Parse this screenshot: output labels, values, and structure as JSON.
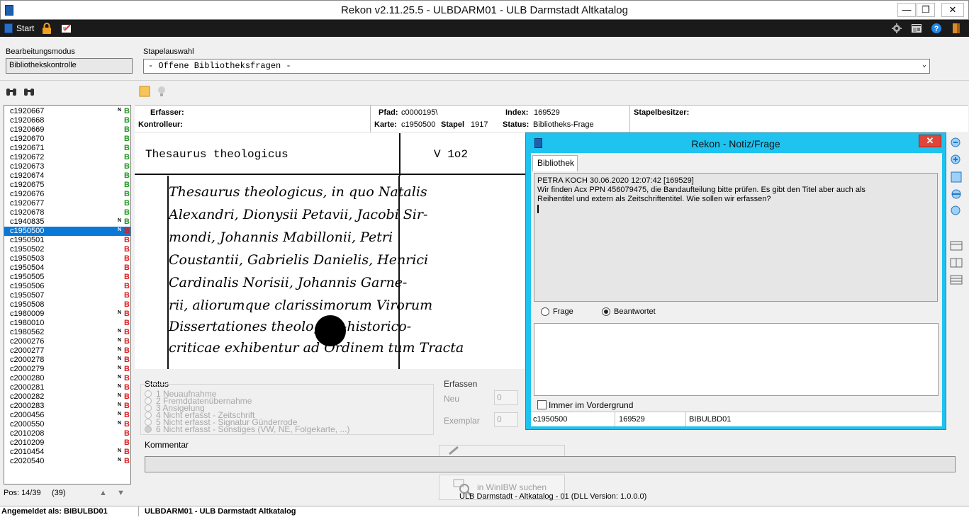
{
  "window": {
    "title": "Rekon v2.11.25.5 - ULBDARM01 - ULB Darmstadt Altkatalog",
    "minimize": "—",
    "restore": "❐",
    "close": "✕"
  },
  "toolbar": {
    "start_label": "Start"
  },
  "mode": {
    "label": "Bearbeitungsmodus",
    "value": "Bibliothekskontrolle",
    "batch_label": "Stapelauswahl",
    "batch_value": "- Offene Bibliotheksfragen -"
  },
  "records": [
    {
      "id": "c1920667",
      "n": "N",
      "s": "B",
      "c": "green"
    },
    {
      "id": "c1920668",
      "n": "",
      "s": "B",
      "c": "green"
    },
    {
      "id": "c1920669",
      "n": "",
      "s": "B",
      "c": "green"
    },
    {
      "id": "c1920670",
      "n": "",
      "s": "B",
      "c": "green"
    },
    {
      "id": "c1920671",
      "n": "",
      "s": "B",
      "c": "green"
    },
    {
      "id": "c1920672",
      "n": "",
      "s": "B",
      "c": "green"
    },
    {
      "id": "c1920673",
      "n": "",
      "s": "B",
      "c": "green"
    },
    {
      "id": "c1920674",
      "n": "",
      "s": "B",
      "c": "green"
    },
    {
      "id": "c1920675",
      "n": "",
      "s": "B",
      "c": "green"
    },
    {
      "id": "c1920676",
      "n": "",
      "s": "B",
      "c": "green"
    },
    {
      "id": "c1920677",
      "n": "",
      "s": "B",
      "c": "green"
    },
    {
      "id": "c1920678",
      "n": "",
      "s": "B",
      "c": "green"
    },
    {
      "id": "c1940835",
      "n": "N",
      "s": "B",
      "c": "green"
    },
    {
      "id": "c1950500",
      "n": "N",
      "s": "B",
      "c": "red",
      "sel": true
    },
    {
      "id": "c1950501",
      "n": "",
      "s": "B",
      "c": "red"
    },
    {
      "id": "c1950502",
      "n": "",
      "s": "B",
      "c": "red"
    },
    {
      "id": "c1950503",
      "n": "",
      "s": "B",
      "c": "red"
    },
    {
      "id": "c1950504",
      "n": "",
      "s": "B",
      "c": "red"
    },
    {
      "id": "c1950505",
      "n": "",
      "s": "B",
      "c": "red"
    },
    {
      "id": "c1950506",
      "n": "",
      "s": "B",
      "c": "red"
    },
    {
      "id": "c1950507",
      "n": "",
      "s": "B",
      "c": "red"
    },
    {
      "id": "c1950508",
      "n": "",
      "s": "B",
      "c": "red"
    },
    {
      "id": "c1980009",
      "n": "N",
      "s": "B",
      "c": "red"
    },
    {
      "id": "c1980010",
      "n": "",
      "s": "B",
      "c": "red"
    },
    {
      "id": "c1980562",
      "n": "N",
      "s": "B",
      "c": "red"
    },
    {
      "id": "c2000276",
      "n": "N",
      "s": "B",
      "c": "red"
    },
    {
      "id": "c2000277",
      "n": "N",
      "s": "B",
      "c": "red"
    },
    {
      "id": "c2000278",
      "n": "N",
      "s": "B",
      "c": "red"
    },
    {
      "id": "c2000279",
      "n": "N",
      "s": "B",
      "c": "red"
    },
    {
      "id": "c2000280",
      "n": "N",
      "s": "B",
      "c": "red"
    },
    {
      "id": "c2000281",
      "n": "N",
      "s": "B",
      "c": "red"
    },
    {
      "id": "c2000282",
      "n": "N",
      "s": "B",
      "c": "red"
    },
    {
      "id": "c2000283",
      "n": "N",
      "s": "B",
      "c": "red"
    },
    {
      "id": "c2000456",
      "n": "N",
      "s": "B",
      "c": "red"
    },
    {
      "id": "c2000550",
      "n": "N",
      "s": "B",
      "c": "red"
    },
    {
      "id": "c2010208",
      "n": "",
      "s": "B",
      "c": "red"
    },
    {
      "id": "c2010209",
      "n": "",
      "s": "B",
      "c": "red"
    },
    {
      "id": "c2010454",
      "n": "N",
      "s": "B",
      "c": "red"
    },
    {
      "id": "c2020540",
      "n": "N",
      "s": "B",
      "c": "red"
    }
  ],
  "list_footer": {
    "pos": "Pos: 14/39",
    "count": "(39)"
  },
  "info": {
    "erfasser_label": "Erfasser:",
    "kontrolleur_label": "Kontrolleur:",
    "pfad_label": "Pfad:",
    "pfad_value": "c0000195\\",
    "karte_label": "Karte:",
    "karte_value": "c1950500",
    "stapel_label": "Stapel",
    "stapel_value": "1917",
    "index_label": "Index:",
    "index_value": "169529",
    "status_label": "Status:",
    "status_value": "Bibliotheks-Frage",
    "owner_label": "Stapelbesitzer:"
  },
  "card": {
    "typed_title": "Thesaurus theologicus",
    "signature": "V 1o2",
    "handwriting": [
      "Thesaurus theologicus, in quo Natalis",
      "Alexandri, Dionysii Petavii, Jacobi Sir-",
      "mondi, Johannis Mabillonii, Petri",
      "Coustantii, Gabrielis Danielis, Henrici",
      "Cardinalis Norisii, Johannis Garne-",
      "rii, aliorumque clarissimorum Virorum",
      "Dissertationes theologico-historico-",
      "criticae exhibentur ad Ordinem tum Tracta"
    ]
  },
  "status": {
    "label": "Status",
    "options": [
      "1  Neuaufnahme",
      "2  Fremddatenübernahme",
      "3  Ansigelung",
      "4  Nicht erfasst - Zeitschrift",
      "5  Nicht erfasst - Signatur Günderrode",
      "6  Nicht erfasst - Sonstiges (VW, NE, Folgekarte, ...)"
    ]
  },
  "erfassen": {
    "label": "Erfassen",
    "neu_label": "Neu",
    "neu_value": "0",
    "exemplar_label": "Exemplar",
    "exemplar_value": "0"
  },
  "kommentar": {
    "label": "Kommentar"
  },
  "buttons": {
    "winibw_search": "in WinIBW suchen"
  },
  "version_text": "ULB Darmstadt - Altkatalog - 01 (DLL Version: 1.0.0.0)",
  "statusbar": {
    "logged_in": "Angemeldet als: BIBULBD01",
    "catalog": "ULBDARM01 - ULB Darmstadt Altkatalog"
  },
  "dialog": {
    "title": "Rekon - Notiz/Frage",
    "close": "✕",
    "tab": "Bibliothek",
    "note_header": "PETRA KOCH     30.06.2020 12:07:42     [169529]",
    "note_line1": "Wir finden Acx PPN  456079475, die Bandaufteilung bitte prüfen. Es gibt den Titel aber auch als",
    "note_line2": "Reihentitel und extern als Zeitschriftentitel. Wie sollen wir erfassen?",
    "radio_frage": "Frage",
    "radio_beantwortet": "Beantwortet",
    "always_on_top": "Immer im Vordergrund",
    "footer_card": "c1950500",
    "footer_index": "169529",
    "footer_user": "BIBULBD01"
  },
  "colors": {
    "selection": "#0a78d7",
    "dialog_frame": "#1ec3f0",
    "status_green": "#1a9a1a",
    "status_red": "#e01b1b"
  }
}
